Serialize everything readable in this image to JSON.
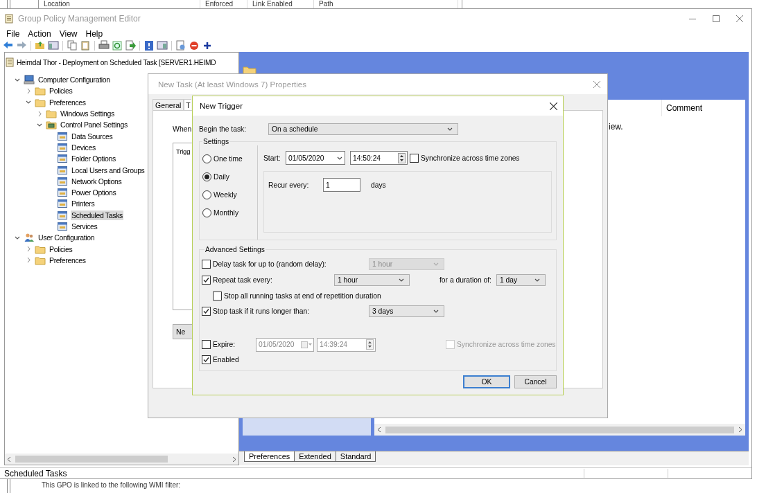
{
  "background_window": {
    "columns": [
      "Location",
      "Enforced",
      "Link Enabled",
      "Path"
    ],
    "wmi_filter_text": "This GPO is linked to the following WMI filter:"
  },
  "window": {
    "title": "Group Policy Management Editor"
  },
  "menu": [
    "File",
    "Action",
    "View",
    "Help"
  ],
  "tree": {
    "root": "Heimdal Thor - Deployment on Scheduled Task [SERVER1.HEIMD",
    "items": [
      {
        "label": "Computer Configuration",
        "kind": "computer",
        "expanded": true,
        "selected": false,
        "children": [
          {
            "label": "Policies",
            "kind": "folder",
            "expanded": false,
            "selected": false
          },
          {
            "label": "Preferences",
            "kind": "folder",
            "expanded": true,
            "selected": false,
            "children": [
              {
                "label": "Windows Settings",
                "kind": "folder",
                "expanded": false,
                "selected": false
              },
              {
                "label": "Control Panel Settings",
                "kind": "control-panel",
                "expanded": true,
                "selected": false,
                "children": [
                  {
                    "label": "Data Sources",
                    "kind": "setting",
                    "selected": false
                  },
                  {
                    "label": "Devices",
                    "kind": "setting",
                    "selected": false
                  },
                  {
                    "label": "Folder Options",
                    "kind": "setting",
                    "selected": false
                  },
                  {
                    "label": "Local Users and Groups",
                    "kind": "setting",
                    "selected": false
                  },
                  {
                    "label": "Network Options",
                    "kind": "setting",
                    "selected": false
                  },
                  {
                    "label": "Power Options",
                    "kind": "setting",
                    "selected": false
                  },
                  {
                    "label": "Printers",
                    "kind": "setting",
                    "selected": false
                  },
                  {
                    "label": "Scheduled Tasks",
                    "kind": "setting",
                    "selected": true
                  },
                  {
                    "label": "Services",
                    "kind": "setting",
                    "selected": false
                  }
                ]
              }
            ]
          }
        ]
      },
      {
        "label": "User Configuration",
        "kind": "users",
        "expanded": true,
        "selected": false,
        "children": [
          {
            "label": "Policies",
            "kind": "folder",
            "expanded": false,
            "selected": false
          },
          {
            "label": "Preferences",
            "kind": "folder",
            "expanded": false,
            "selected": false
          }
        ]
      }
    ]
  },
  "details_pane": {
    "column": "Comment",
    "text": "iew.",
    "tabs": [
      {
        "label": "Preferences",
        "selected": true
      },
      {
        "label": "Extended",
        "selected": false
      },
      {
        "label": "Standard",
        "selected": false
      }
    ]
  },
  "status_bar": "Scheduled Tasks",
  "task_dialog": {
    "title": "New Task (At least Windows 7) Properties",
    "tabs": [
      {
        "label": "General",
        "selected": false
      },
      {
        "label": "T",
        "selected": true
      }
    ],
    "prompt": "When",
    "list_header": "Trigg",
    "button": "Ne"
  },
  "trigger_dialog": {
    "title": "New Trigger",
    "begin_label": "Begin the task:",
    "begin_value": "On a schedule",
    "settings": {
      "legend": "Settings",
      "schedules": [
        {
          "label": "One time",
          "selected": false
        },
        {
          "label": "Daily",
          "selected": true
        },
        {
          "label": "Weekly",
          "selected": false
        },
        {
          "label": "Monthly",
          "selected": false
        }
      ],
      "start_label": "Start:",
      "start_date": "01/05/2020",
      "start_time": "14:50:24",
      "sync": {
        "label": "Synchronize across time zones",
        "checked": false
      },
      "recur_label": "Recur every:",
      "recur_value": "1",
      "recur_unit": "days"
    },
    "advanced": {
      "legend": "Advanced Settings",
      "delay": {
        "label": "Delay task for up to (random delay):",
        "checked": false,
        "value": "1 hour",
        "disabled": true
      },
      "repeat": {
        "label": "Repeat task every:",
        "checked": true,
        "value": "1 hour",
        "duration_label": "for a duration of:",
        "duration_value": "1 day"
      },
      "stop_all": {
        "label": "Stop all running tasks at end of repetition duration",
        "checked": false
      },
      "stop_if": {
        "label": "Stop task if it runs longer than:",
        "checked": true,
        "value": "3 days"
      },
      "expire": {
        "label": "Expire:",
        "checked": false,
        "disabled": true,
        "date": "01/05/2020",
        "time": "14:39:24",
        "sync_label": "Synchronize across time zones",
        "sync_checked": false
      },
      "enabled": {
        "label": "Enabled",
        "checked": true
      }
    },
    "buttons": [
      {
        "label": "OK",
        "default": true
      },
      {
        "label": "Cancel",
        "default": false
      }
    ]
  }
}
